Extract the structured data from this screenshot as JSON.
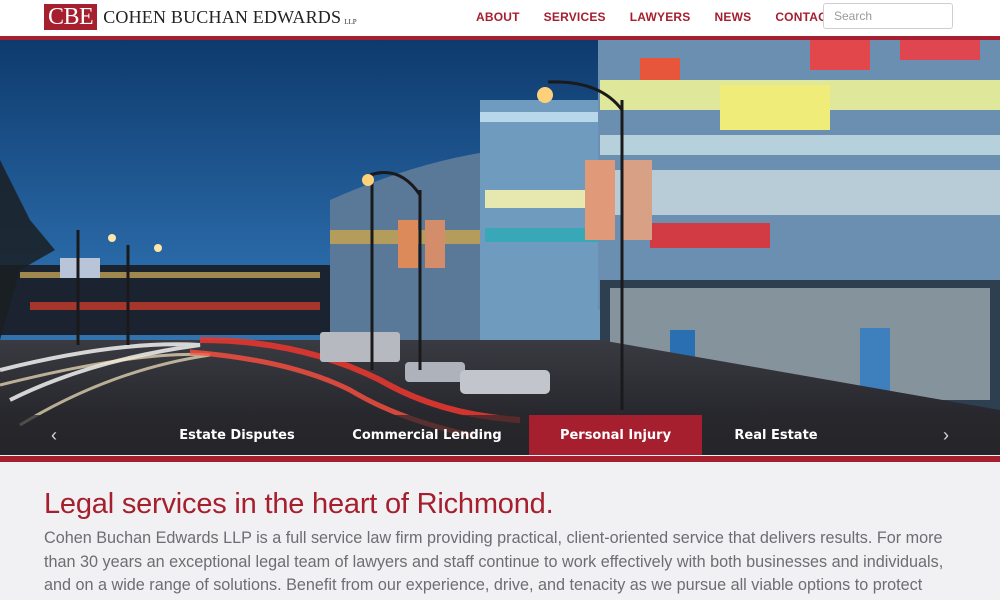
{
  "logo": {
    "mark": "CBE",
    "name": "COHEN BUCHAN EDWARDS",
    "suffix": "LLP"
  },
  "nav": [
    "ABOUT",
    "SERVICES",
    "LAWYERS",
    "NEWS",
    "CONTACT"
  ],
  "search": {
    "placeholder": "Search",
    "value": ""
  },
  "hero": {
    "prev_icon": "chevron-left-icon",
    "next_icon": "chevron-right-icon",
    "prev_glyph": "‹",
    "next_glyph": "›",
    "tabs": [
      "Estate Disputes",
      "Commercial Lending",
      "Personal Injury",
      "Real Estate"
    ],
    "active_tab": "Personal Injury"
  },
  "content": {
    "headline": "Legal services in the heart of Richmond.",
    "intro": "Cohen Buchan Edwards LLP is a full service law firm providing practical, client-oriented service that delivers results. For more than 30 years an exceptional legal team of lawyers and staff continue to work effectively with both businesses and individuals, and on a wide range of solutions. Benefit from our experience, drive, and tenacity as we pursue all viable options to protect"
  },
  "colors": {
    "brand": "#a51f2e",
    "text_grey": "#6d6d72",
    "page_bg": "#f1f1f3"
  }
}
